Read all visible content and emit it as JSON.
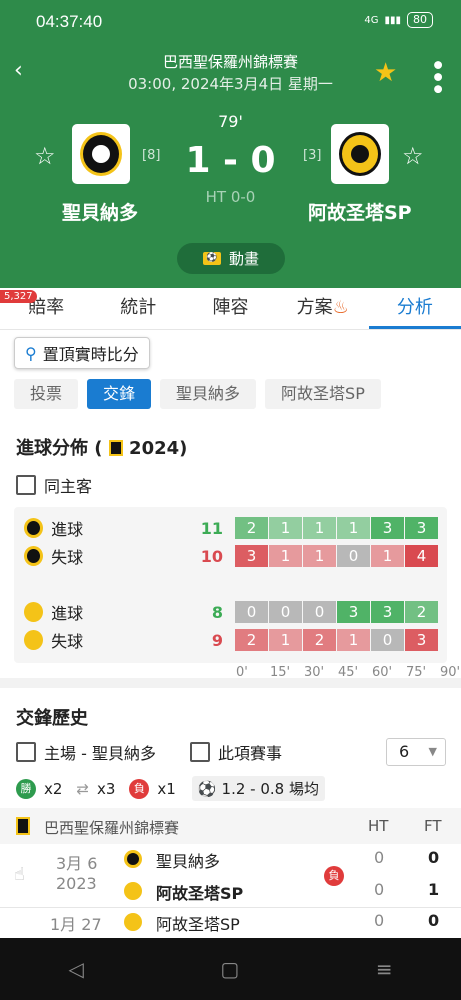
{
  "status": {
    "time": "04:37:40",
    "network": "4G",
    "battery": "80"
  },
  "match": {
    "league": "巴西聖保羅州錦標賽",
    "date": "03:00, 2024年3月4日 星期一",
    "minute": "79'",
    "score": "1 - 0",
    "ht": "HT 0-0",
    "home": {
      "name": "聖貝納多",
      "rank": "[8]"
    },
    "away": {
      "name": "阿故圣塔SP",
      "rank": "[3]"
    },
    "animation": "動畫"
  },
  "colors": {
    "header": "#2e8b4a",
    "accent": "#1a7cd1",
    "scored": "#3cab55",
    "conceded": "#d94a50",
    "favorite": "#f4c318"
  },
  "badge": "5,327",
  "tabs": [
    "賠率",
    "統計",
    "陣容",
    "方案",
    "分析"
  ],
  "pin_label": "置頂實時比分",
  "subtabs": [
    "投票",
    "交鋒",
    "聖貝納多",
    "阿故圣塔SP"
  ],
  "goals": {
    "title": "進球分佈 ( ",
    "year": "2024)",
    "same_home_away": "同主客",
    "rows": [
      {
        "team": "home",
        "label": "進球",
        "total": "11",
        "values": [
          "2",
          "1",
          "1",
          "1",
          "3",
          "3"
        ]
      },
      {
        "team": "home",
        "label": "失球",
        "total": "10",
        "values": [
          "3",
          "1",
          "1",
          "0",
          "1",
          "4"
        ]
      },
      {
        "team": "away",
        "label": "進球",
        "total": "8",
        "values": [
          "0",
          "0",
          "0",
          "3",
          "3",
          "2"
        ]
      },
      {
        "team": "away",
        "label": "失球",
        "total": "9",
        "values": [
          "2",
          "1",
          "2",
          "1",
          "0",
          "3"
        ]
      }
    ],
    "axis": [
      "0'",
      "15'",
      "30'",
      "45'",
      "60'",
      "75'",
      "90'"
    ]
  },
  "h2h": {
    "title": "交鋒歷史",
    "home_filter": "主場 - 聖貝納多",
    "competition_filter": "此項賽事",
    "count": "6",
    "record": {
      "wins": "x2",
      "draws": "x3",
      "losses": "x1",
      "win_label": "勝",
      "loss_label": "負",
      "avg": "1.2 - 0.8 場均"
    },
    "league": "巴西聖保羅州錦標賽",
    "cols": [
      "HT",
      "FT"
    ],
    "matches": [
      {
        "date": "3月 6",
        "year": "2023",
        "home": "聖貝納多",
        "away": "阿故圣塔SP",
        "result": "負",
        "ht": [
          "0",
          "0"
        ],
        "ft": [
          "0",
          "1"
        ]
      },
      {
        "date": "1月 27",
        "home": "阿故圣塔SP",
        "ht": [
          "0"
        ],
        "ft": [
          "0"
        ]
      }
    ]
  }
}
